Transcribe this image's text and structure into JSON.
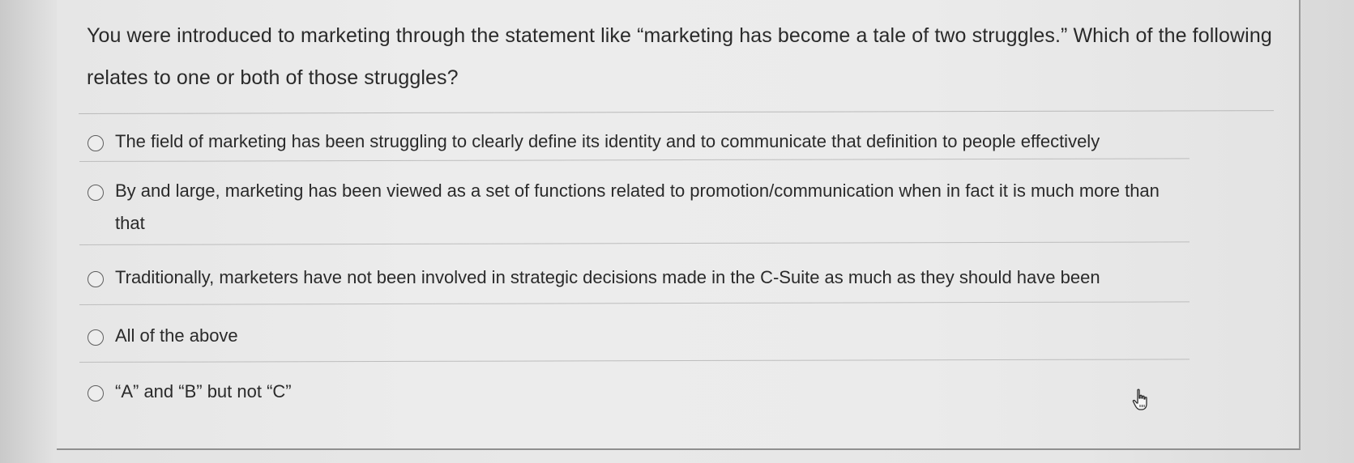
{
  "question": {
    "text": "You were introduced to marketing through the statement like “marketing has become a tale of two struggles.” Which of the following relates to one or both of those struggles?"
  },
  "options": [
    {
      "label": "The field of marketing has been struggling to clearly define its identity and to communicate that definition to people effectively",
      "selected": false
    },
    {
      "label": "By and large, marketing has been viewed as a set of functions related to promotion/communication when in fact it is much more than that",
      "selected": false
    },
    {
      "label": "Traditionally, marketers have not been involved in strategic decisions made in the C-Suite as much as they should have been",
      "selected": false
    },
    {
      "label": "All of the above",
      "selected": false
    },
    {
      "label": "“A” and “B” but not “C”",
      "selected": false
    }
  ],
  "icons": {
    "radio": "radio-unselected-icon",
    "cursor": "hand-pointer-cursor-icon"
  },
  "colors": {
    "card_background": "#ebebeb",
    "text": "#2a2a2a",
    "divider": "#bdbdbd"
  }
}
